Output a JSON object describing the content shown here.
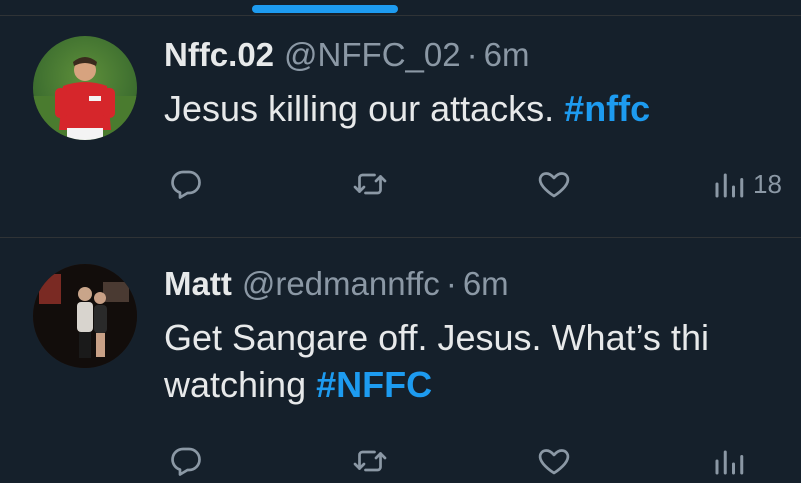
{
  "tweets": [
    {
      "display_name": "Nffc.02",
      "handle": "@NFFC_02",
      "separator": "·",
      "time": "6m",
      "text": "Jesus killing our attacks. ",
      "hashtag": "#nffc",
      "views": "18",
      "icons": [
        "reply-icon",
        "retweet-icon",
        "like-icon",
        "views-icon"
      ]
    },
    {
      "display_name": "Matt",
      "handle": "@redmannffc",
      "separator": "·",
      "time": "6m",
      "text_line1": "Get Sangare off. Jesus. What’s thi",
      "text_line2": "watching ",
      "hashtag": "#NFFC",
      "icons": [
        "reply-icon",
        "retweet-icon",
        "like-icon",
        "views-icon"
      ]
    }
  ],
  "colors": {
    "background": "#15202b",
    "text": "#e7e9ea",
    "muted": "#8b98a5",
    "accent": "#1d9bf0",
    "divider": "#2f3336"
  }
}
